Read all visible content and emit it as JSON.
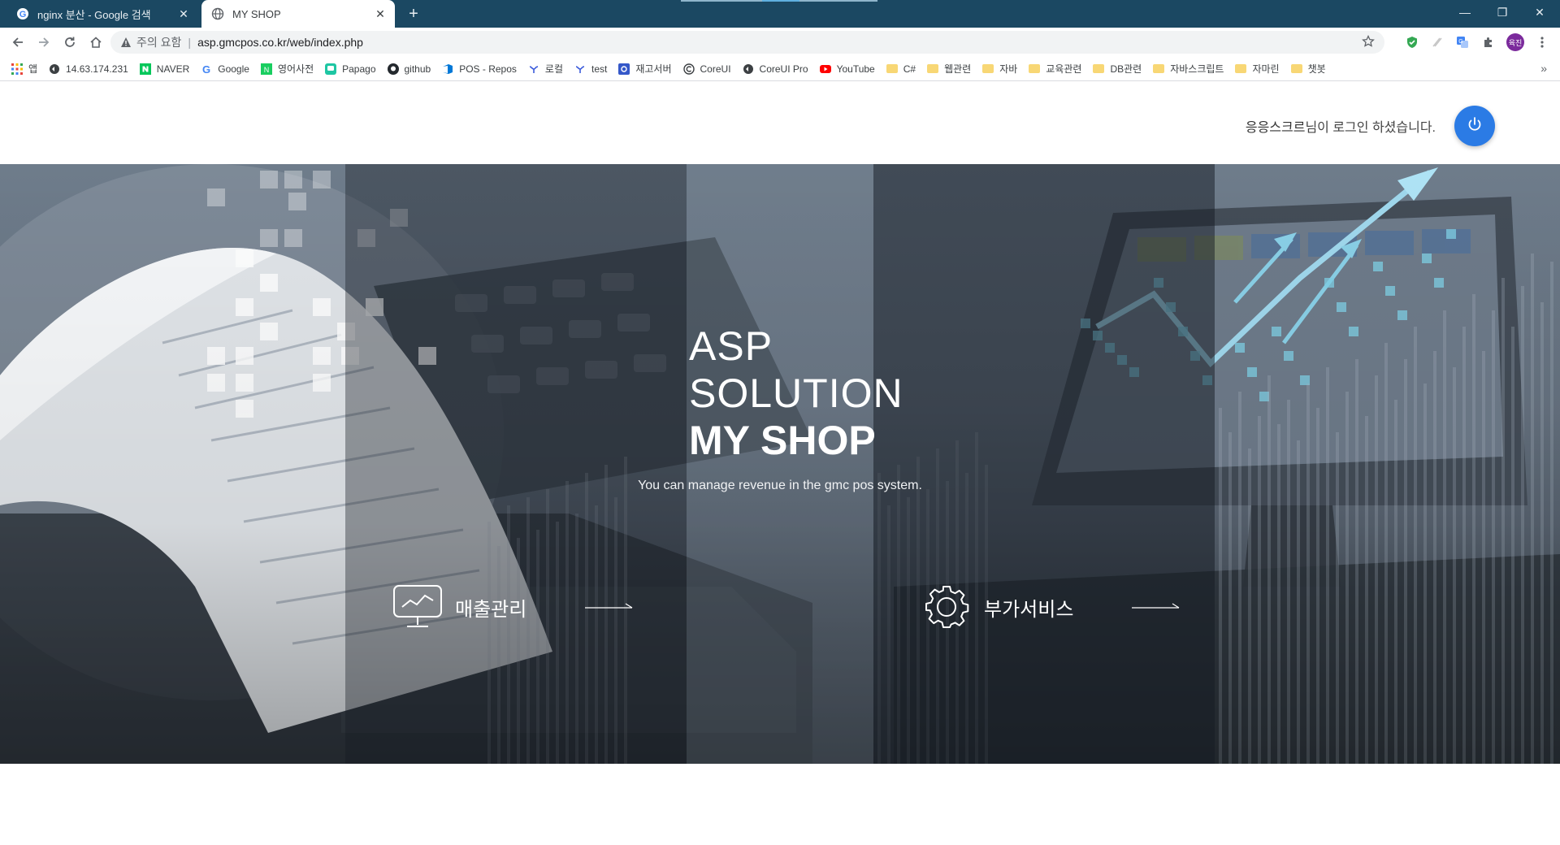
{
  "browser": {
    "tabs": [
      {
        "title": "nginx 분산 - Google 검색",
        "active": false,
        "icon": "google-g-icon"
      },
      {
        "title": "MY SHOP",
        "active": true,
        "icon": "globe-icon"
      }
    ],
    "address": {
      "security_label": "주의 요함",
      "url": "asp.gmcpos.co.kr/web/index.php"
    },
    "profile_initials": "육진",
    "bookmarks": [
      {
        "label": "앱",
        "icon": "apps-grid-icon"
      },
      {
        "label": "14.63.174.231",
        "icon": "globe-icon"
      },
      {
        "label": "NAVER",
        "icon": "naver-icon"
      },
      {
        "label": "Google",
        "icon": "google-g-icon"
      },
      {
        "label": "영어사전",
        "icon": "dictionary-icon"
      },
      {
        "label": "Papago",
        "icon": "papago-icon"
      },
      {
        "label": "github",
        "icon": "github-icon"
      },
      {
        "label": "POS - Repos",
        "icon": "azure-devops-icon"
      },
      {
        "label": "로컬",
        "icon": "local-icon"
      },
      {
        "label": "test",
        "icon": "local-icon"
      },
      {
        "label": "재고서버",
        "icon": "server-icon"
      },
      {
        "label": "CoreUI",
        "icon": "coreui-icon"
      },
      {
        "label": "CoreUI Pro",
        "icon": "globe-icon"
      },
      {
        "label": "YouTube",
        "icon": "youtube-icon"
      },
      {
        "label": "C#",
        "icon": "folder-icon"
      },
      {
        "label": "웹관련",
        "icon": "folder-icon"
      },
      {
        "label": "자바",
        "icon": "folder-icon"
      },
      {
        "label": "교육관련",
        "icon": "folder-icon"
      },
      {
        "label": "DB관련",
        "icon": "folder-icon"
      },
      {
        "label": "자바스크립트",
        "icon": "folder-icon"
      },
      {
        "label": "자마린",
        "icon": "folder-icon"
      },
      {
        "label": "챗봇",
        "icon": "folder-icon"
      }
    ],
    "bookmarks_more": "»"
  },
  "header": {
    "user_name": "응응스크르",
    "login_suffix": "님이 로그인 하셨습니다.",
    "power_button_color": "#2b7be5"
  },
  "hero": {
    "title_line1": "ASP",
    "title_line2": "SOLUTION",
    "title_line3": "MY SHOP",
    "subtitle": "You can manage revenue in the gmc pos system.",
    "menus": [
      {
        "label": "매출관리",
        "icon": "monitor-chart-icon"
      },
      {
        "label": "부가서비스",
        "icon": "gear-icon"
      }
    ]
  },
  "colors": {
    "tabbar": "#1b4862",
    "accent": "#2b7be5",
    "hero_overlay": "#1f252c"
  }
}
